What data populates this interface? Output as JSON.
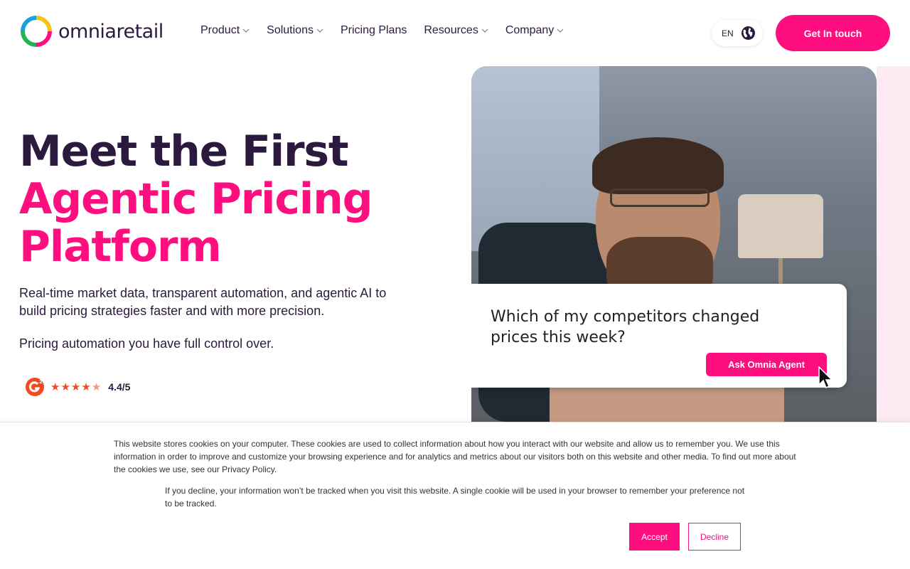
{
  "header": {
    "logo_text": "omniaretail",
    "nav": [
      {
        "label": "Product",
        "dropdown": true
      },
      {
        "label": "Solutions",
        "dropdown": true
      },
      {
        "label": "Pricing Plans",
        "dropdown": false
      },
      {
        "label": "Resources",
        "dropdown": true
      },
      {
        "label": "Company",
        "dropdown": true
      }
    ],
    "language": "EN",
    "cta_label": "Get In touch"
  },
  "hero": {
    "title_line1": "Meet the First",
    "title_line2": "Agentic Pricing",
    "title_line3": "Platform",
    "description": "Real-time market data, transparent automation, and agentic AI to build pricing strategies faster and with more precision.",
    "subtext": "Pricing automation you have full control over.",
    "rating": {
      "stars": 4.4,
      "score_text": "4.4/5"
    }
  },
  "hero_image": {
    "chat_question": "Which of my competitors changed prices this week?",
    "chat_button": "Ask Omnia Agent"
  },
  "cookie_banner": {
    "text1": "This website stores cookies on your computer. These cookies are used to collect information about how you interact with our website and allow us to remember you. We use this information in order to improve and customize your browsing experience and for analytics and metrics about our visitors both on this website and other media. To find out more about the cookies we use, see our Privacy Policy.",
    "text2": "If you decline, your information won’t be tracked when you visit this website. A single cookie will be used in your browser to remember your preference not to be tracked.",
    "accept_label": "Accept",
    "decline_label": "Decline"
  },
  "colors": {
    "brand_pink": "#ff0e7f",
    "dark_text": "#2b1a3d"
  }
}
